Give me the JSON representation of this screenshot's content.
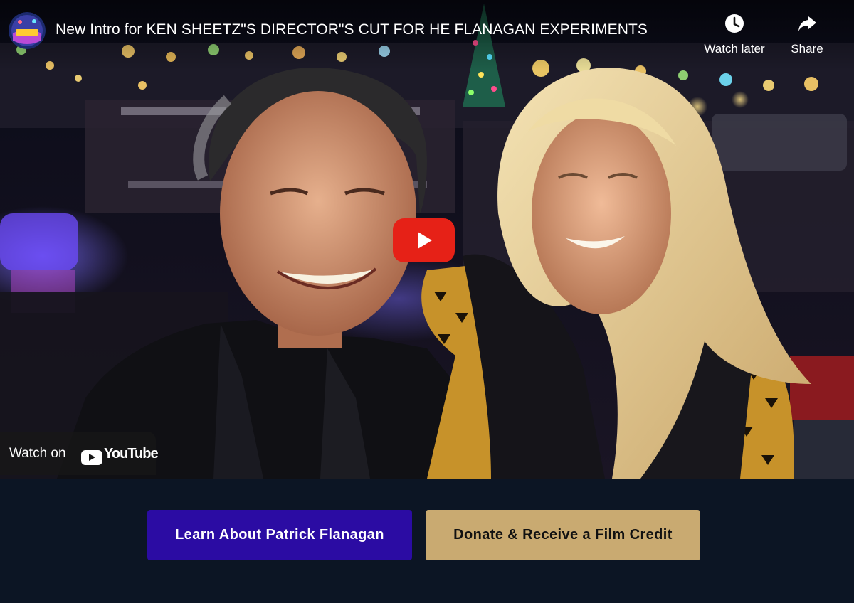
{
  "video": {
    "title": "New Intro for KEN SHEETZ\"S DIRECTOR\"S CUT FOR HE FLANAGAN EXPERIMENTS",
    "channel_avatar_icon": "channel-logo-icon",
    "actions": {
      "watch_later_label": "Watch later",
      "watch_later_icon": "clock-icon",
      "share_label": "Share",
      "share_icon": "share-arrow-icon"
    },
    "play_icon": "play-icon",
    "watch_on": {
      "prefix": "Watch on",
      "brand": "YouTube",
      "logo_icon": "youtube-logo-icon"
    }
  },
  "buttons": {
    "learn_label": "Learn About Patrick Flanagan",
    "donate_label": "Donate & Receive a Film Credit"
  },
  "colors": {
    "page_background": "#0c1524",
    "learn_button": "#2b0ca3",
    "donate_button": "#c9aa71",
    "youtube_red": "#e62117"
  }
}
